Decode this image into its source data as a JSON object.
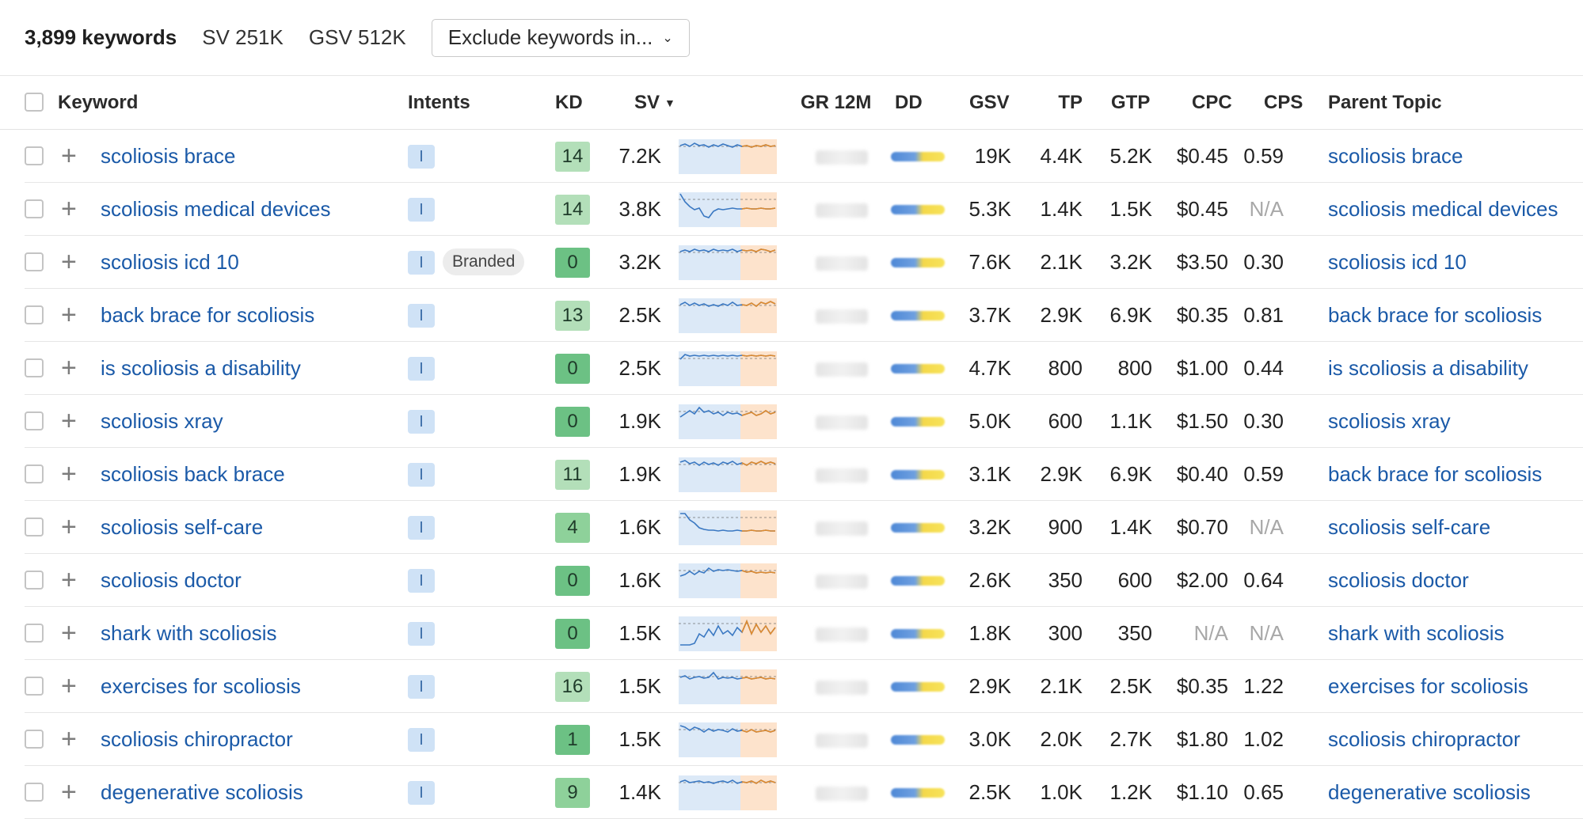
{
  "summary": {
    "keyword_count": "3,899 keywords",
    "sv": "SV 251K",
    "gsv": "GSV 512K",
    "exclude_label": "Exclude keywords in..."
  },
  "columns": {
    "keyword": "Keyword",
    "intents": "Intents",
    "kd": "KD",
    "sv": "SV",
    "gr12m": "GR 12M",
    "dd": "DD",
    "gsv": "GSV",
    "tp": "TP",
    "gtp": "GTP",
    "cpc": "CPC",
    "cps": "CPS",
    "parent_topic": "Parent Topic"
  },
  "colors": {
    "link": "#1b5aa8",
    "intent_bg": "#cfe2f6",
    "kd_light": "#b3dfb9",
    "kd_mid": "#8ed19a",
    "kd_strong": "#6cc184",
    "spark_blue": "#3a78c2",
    "spark_orange": "#e08a2c"
  },
  "rows": [
    {
      "keyword": "scoliosis brace",
      "intent": "I",
      "branded": "",
      "kd": "14",
      "sv": "7.2K",
      "gsv": "19K",
      "tp": "4.4K",
      "gtp": "5.2K",
      "cpc": "$0.45",
      "cps": "0.59",
      "parent": "scoliosis brace"
    },
    {
      "keyword": "scoliosis medical devices",
      "intent": "I",
      "branded": "",
      "kd": "14",
      "sv": "3.8K",
      "gsv": "5.3K",
      "tp": "1.4K",
      "gtp": "1.5K",
      "cpc": "$0.45",
      "cps": "N/A",
      "parent": "scoliosis medical devices"
    },
    {
      "keyword": "scoliosis icd 10",
      "intent": "I",
      "branded": "Branded",
      "kd": "0",
      "sv": "3.2K",
      "gsv": "7.6K",
      "tp": "2.1K",
      "gtp": "3.2K",
      "cpc": "$3.50",
      "cps": "0.30",
      "parent": "scoliosis icd 10"
    },
    {
      "keyword": "back brace for scoliosis",
      "intent": "I",
      "branded": "",
      "kd": "13",
      "sv": "2.5K",
      "gsv": "3.7K",
      "tp": "2.9K",
      "gtp": "6.9K",
      "cpc": "$0.35",
      "cps": "0.81",
      "parent": "back brace for scoliosis"
    },
    {
      "keyword": "is scoliosis a disability",
      "intent": "I",
      "branded": "",
      "kd": "0",
      "sv": "2.5K",
      "gsv": "4.7K",
      "tp": "800",
      "gtp": "800",
      "cpc": "$1.00",
      "cps": "0.44",
      "parent": "is scoliosis a disability"
    },
    {
      "keyword": "scoliosis xray",
      "intent": "I",
      "branded": "",
      "kd": "0",
      "sv": "1.9K",
      "gsv": "5.0K",
      "tp": "600",
      "gtp": "1.1K",
      "cpc": "$1.50",
      "cps": "0.30",
      "parent": "scoliosis xray"
    },
    {
      "keyword": "scoliosis back brace",
      "intent": "I",
      "branded": "",
      "kd": "11",
      "sv": "1.9K",
      "gsv": "3.1K",
      "tp": "2.9K",
      "gtp": "6.9K",
      "cpc": "$0.40",
      "cps": "0.59",
      "parent": "back brace for scoliosis"
    },
    {
      "keyword": "scoliosis self-care",
      "intent": "I",
      "branded": "",
      "kd": "4",
      "sv": "1.6K",
      "gsv": "3.2K",
      "tp": "900",
      "gtp": "1.4K",
      "cpc": "$0.70",
      "cps": "N/A",
      "parent": "scoliosis self-care"
    },
    {
      "keyword": "scoliosis doctor",
      "intent": "I",
      "branded": "",
      "kd": "0",
      "sv": "1.6K",
      "gsv": "2.6K",
      "tp": "350",
      "gtp": "600",
      "cpc": "$2.00",
      "cps": "0.64",
      "parent": "scoliosis doctor"
    },
    {
      "keyword": "shark with scoliosis",
      "intent": "I",
      "branded": "",
      "kd": "0",
      "sv": "1.5K",
      "gsv": "1.8K",
      "tp": "300",
      "gtp": "350",
      "cpc": "N/A",
      "cps": "N/A",
      "parent": "shark with scoliosis"
    },
    {
      "keyword": "exercises for scoliosis",
      "intent": "I",
      "branded": "",
      "kd": "16",
      "sv": "1.5K",
      "gsv": "2.9K",
      "tp": "2.1K",
      "gtp": "2.5K",
      "cpc": "$0.35",
      "cps": "1.22",
      "parent": "exercises for scoliosis"
    },
    {
      "keyword": "scoliosis chiropractor",
      "intent": "I",
      "branded": "",
      "kd": "1",
      "sv": "1.5K",
      "gsv": "3.0K",
      "tp": "2.0K",
      "gtp": "2.7K",
      "cpc": "$1.80",
      "cps": "1.02",
      "parent": "scoliosis chiropractor"
    },
    {
      "keyword": "degenerative scoliosis",
      "intent": "I",
      "branded": "",
      "kd": "9",
      "sv": "1.4K",
      "gsv": "2.5K",
      "tp": "1.0K",
      "gtp": "1.2K",
      "cpc": "$1.10",
      "cps": "0.65",
      "parent": "degenerative scoliosis"
    }
  ]
}
